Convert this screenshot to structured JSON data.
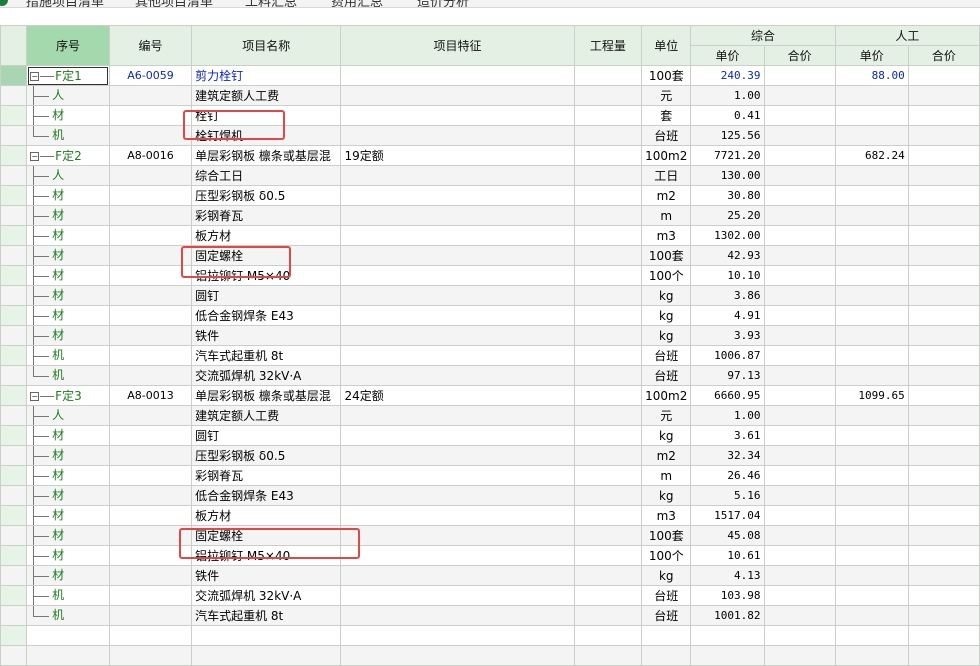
{
  "tabs": [
    "措施项目清单",
    "其他项目清单",
    "工料汇总",
    "费用汇总",
    "造价分析"
  ],
  "headers": {
    "seq": "序号",
    "code": "编号",
    "name": "项目名称",
    "feature": "项目特征",
    "qty": "工程量",
    "unit": "单位",
    "zonghe": "综合",
    "rengong": "人工",
    "unit_price": "单价",
    "total_price": "合价",
    "rg_unit_price": "单价",
    "rg_total_price": "合价"
  },
  "rows": [
    {
      "seq": "F定1",
      "level": 0,
      "code": "A6-0059",
      "name": "剪力栓钉",
      "feature": "",
      "unit": "100套",
      "price": "240.39",
      "rg": "88.00",
      "blue": true
    },
    {
      "seq": "人",
      "level": 1,
      "name": "建筑定额人工费",
      "unit": "元",
      "price": "1.00"
    },
    {
      "seq": "材",
      "level": 1,
      "name": "栓钉",
      "unit": "套",
      "price": "0.41"
    },
    {
      "seq": "机",
      "level": 1,
      "last": true,
      "name": "栓钉焊机",
      "unit": "台班",
      "price": "125.56"
    },
    {
      "seq": "F定2",
      "level": 0,
      "code": "A8-0016",
      "name": "单层彩钢板 檩条或基层混",
      "feature": "19定额",
      "unit": "100m2",
      "price": "7721.20",
      "rg": "682.24"
    },
    {
      "seq": "人",
      "level": 1,
      "name": "综合工日",
      "unit": "工日",
      "price": "130.00"
    },
    {
      "seq": "材",
      "level": 1,
      "name": "压型彩钢板 δ0.5",
      "unit": "m2",
      "price": "30.80"
    },
    {
      "seq": "材",
      "level": 1,
      "name": "彩钢脊瓦",
      "unit": "m",
      "price": "25.20"
    },
    {
      "seq": "材",
      "level": 1,
      "name": "板方材",
      "unit": "m3",
      "price": "1302.00"
    },
    {
      "seq": "材",
      "level": 1,
      "name": "固定螺栓",
      "unit": "100套",
      "price": "42.93"
    },
    {
      "seq": "材",
      "level": 1,
      "name": "铝拉铆钉 M5×40",
      "unit": "100个",
      "price": "10.10"
    },
    {
      "seq": "材",
      "level": 1,
      "name": "圆钉",
      "unit": "kg",
      "price": "3.86"
    },
    {
      "seq": "材",
      "level": 1,
      "name": "低合金钢焊条 E43",
      "unit": "kg",
      "price": "4.91"
    },
    {
      "seq": "材",
      "level": 1,
      "name": "铁件",
      "unit": "kg",
      "price": "3.93"
    },
    {
      "seq": "机",
      "level": 1,
      "name": "汽车式起重机 8t",
      "unit": "台班",
      "price": "1006.87"
    },
    {
      "seq": "机",
      "level": 1,
      "last": true,
      "name": "交流弧焊机 32kV·A",
      "unit": "台班",
      "price": "97.13"
    },
    {
      "seq": "F定3",
      "level": 0,
      "code": "A8-0013",
      "name": "单层彩钢板 檩条或基层混",
      "feature": "24定额",
      "unit": "100m2",
      "price": "6660.95",
      "rg": "1099.65"
    },
    {
      "seq": "人",
      "level": 1,
      "name": "建筑定额人工费",
      "unit": "元",
      "price": "1.00"
    },
    {
      "seq": "材",
      "level": 1,
      "name": "圆钉",
      "unit": "kg",
      "price": "3.61"
    },
    {
      "seq": "材",
      "level": 1,
      "name": "压型彩钢板 δ0.5",
      "unit": "m2",
      "price": "32.34"
    },
    {
      "seq": "材",
      "level": 1,
      "name": "彩钢脊瓦",
      "unit": "m",
      "price": "26.46"
    },
    {
      "seq": "材",
      "level": 1,
      "name": "低合金钢焊条 E43",
      "unit": "kg",
      "price": "5.16"
    },
    {
      "seq": "材",
      "level": 1,
      "name": "板方材",
      "unit": "m3",
      "price": "1517.04"
    },
    {
      "seq": "材",
      "level": 1,
      "name": "固定螺栓",
      "unit": "100套",
      "price": "45.08"
    },
    {
      "seq": "材",
      "level": 1,
      "name": "铝拉铆钉 M5×40",
      "unit": "100个",
      "price": "10.61"
    },
    {
      "seq": "材",
      "level": 1,
      "name": "铁件",
      "unit": "kg",
      "price": "4.13"
    },
    {
      "seq": "机",
      "level": 1,
      "name": "交流弧焊机 32kV·A",
      "unit": "台班",
      "price": "103.98"
    },
    {
      "seq": "机",
      "level": 1,
      "last": true,
      "name": "汽车式起重机 8t",
      "unit": "台班",
      "price": "1001.82"
    }
  ],
  "highlight_color": "#e04848",
  "accent_color": "#a3d9ad"
}
